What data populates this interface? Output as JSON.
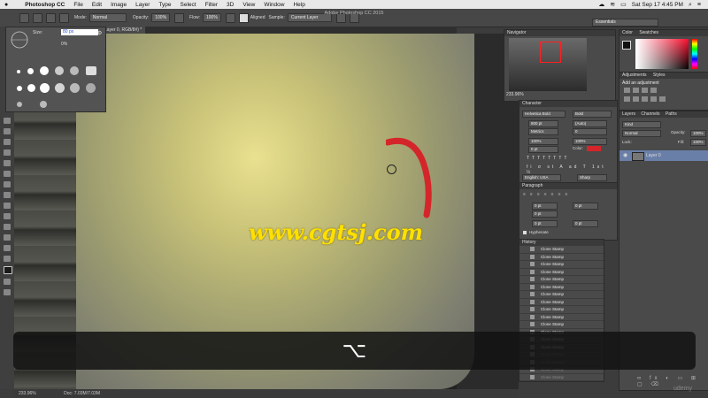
{
  "menubar": {
    "app": "Photoshop CC",
    "items": [
      "File",
      "Edit",
      "Image",
      "Layer",
      "Type",
      "Select",
      "Filter",
      "3D",
      "View",
      "Window",
      "Help"
    ],
    "datetime": "Sat Sep 17  4:45 PM"
  },
  "window_title": "Adobe Photoshop CC 2015",
  "options": {
    "mode_label": "Mode:",
    "mode_value": "Normal",
    "opacity_label": "Opacity:",
    "opacity_value": "100%",
    "flow_label": "Flow:",
    "flow_value": "100%",
    "aligned_label": "Aligned",
    "sample_label": "Sample:",
    "sample_value": "Current Layer",
    "workspace": "Essentials"
  },
  "document_tab": "Layer 0, RGB/8#) *",
  "brush_popup": {
    "size_label": "Size:",
    "size_value": "80 px",
    "hardness_value": "0%"
  },
  "watermark": "www.cgtsj.com",
  "status": {
    "zoom": "233.96%",
    "doc": "Doc: 7.03M/7.03M"
  },
  "navigator": {
    "title": "Navigator",
    "zoom": "233.96%"
  },
  "color": {
    "tabs": [
      "Color",
      "Swatches"
    ]
  },
  "adjustments": {
    "tabs": [
      "Adjustments",
      "Styles"
    ],
    "subtitle": "Add an adjustment"
  },
  "character": {
    "title": "Character",
    "font_family": "Helvetica Bold",
    "font_style": "Bold",
    "size": "800 pt",
    "leading": "(Auto)",
    "kerning": "Metrics",
    "tracking": "0",
    "vscale": "100%",
    "hscale": "100%",
    "baseline": "0 pt",
    "color_label": "Color:",
    "language": "English: USA",
    "antialias": "Sharp"
  },
  "paragraph": {
    "title": "Paragraph",
    "indent_left": "0 pt",
    "indent_right": "0 pt",
    "indent_first": "0 pt",
    "space_before": "0 pt",
    "space_after": "0 pt",
    "hyphenate": "Hyphenate"
  },
  "history": {
    "title": "History",
    "items": [
      "Clone Stamp",
      "Clone Stamp",
      "Clone Stamp",
      "Clone Stamp",
      "Clone Stamp",
      "Clone Stamp",
      "Clone Stamp",
      "Clone Stamp",
      "Clone Stamp",
      "Clone Stamp",
      "Clone Stamp",
      "Clone Stamp",
      "Clone Stamp",
      "Clone Stamp",
      "Clone Stamp",
      "Clone Stamp",
      "Clone Stamp",
      "Clone Stamp",
      "Clone Stamp"
    ]
  },
  "layers": {
    "tabs": [
      "Layers",
      "Channels",
      "Paths"
    ],
    "kind": "Kind",
    "blend": "Normal",
    "opacity_label": "Opacity:",
    "opacity_value": "100%",
    "lock_label": "Lock:",
    "fill_label": "Fill:",
    "fill_value": "100%",
    "layer_name": "Layer 0"
  },
  "key_overlay": "⌥",
  "brand": "udemy"
}
